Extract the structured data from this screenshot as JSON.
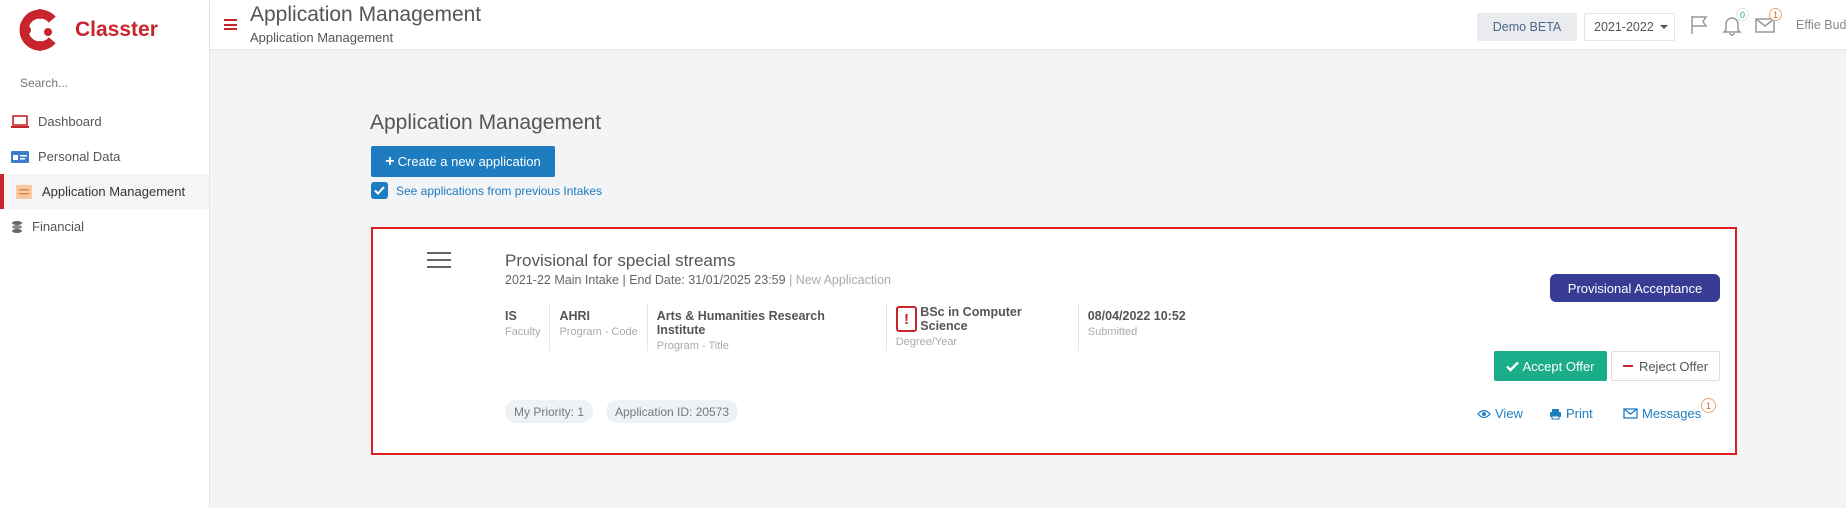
{
  "app": {
    "name": "Classter",
    "brand_color": "#c8242b",
    "accent_color": "#1e7cc1"
  },
  "sidebar": {
    "search_placeholder": "Search...",
    "items": [
      {
        "label": "Dashboard",
        "icon": "laptop-icon",
        "active": false
      },
      {
        "label": "Personal Data",
        "icon": "id-card-icon",
        "active": false
      },
      {
        "label": "Application Management",
        "icon": "application-icon",
        "active": true
      },
      {
        "label": "Financial",
        "icon": "coins-icon",
        "active": false
      }
    ]
  },
  "header": {
    "title": "Application Management",
    "subtitle": "Application Management",
    "demo_label": "Demo BETA",
    "year": "2021-2022",
    "notifications_count": "0",
    "messages_count": "1",
    "user_name": "Effie Bud"
  },
  "main": {
    "title": "Application Management",
    "create_button": "Create a new application",
    "previous_intakes_label": "See applications from previous Intakes",
    "previous_intakes_checked": true
  },
  "application": {
    "title": "Provisional for special streams",
    "intake": "2021-22 Main Intake",
    "end_date": "End Date: 31/01/2025 23:59",
    "type": "New Applicaction",
    "status": "Provisional Acceptance",
    "status_color": "#373b94",
    "details": [
      {
        "value": "IS",
        "label": "Faculty"
      },
      {
        "value": "AHRI",
        "label": "Program - Code"
      },
      {
        "value": "Arts & Humanities Research Institute",
        "label": "Program - Title"
      },
      {
        "value": "BSc in Computer Science",
        "label": "Degree/Year"
      },
      {
        "value": "08/04/2022 10:52",
        "label": "Submitted"
      }
    ],
    "accept_label": "Accept Offer",
    "reject_label": "Reject Offer",
    "priority": "My Priority: 1",
    "application_id": "Application ID: 20573",
    "view_label": "View",
    "print_label": "Print",
    "messages_label": "Messages",
    "messages_count": "1"
  }
}
